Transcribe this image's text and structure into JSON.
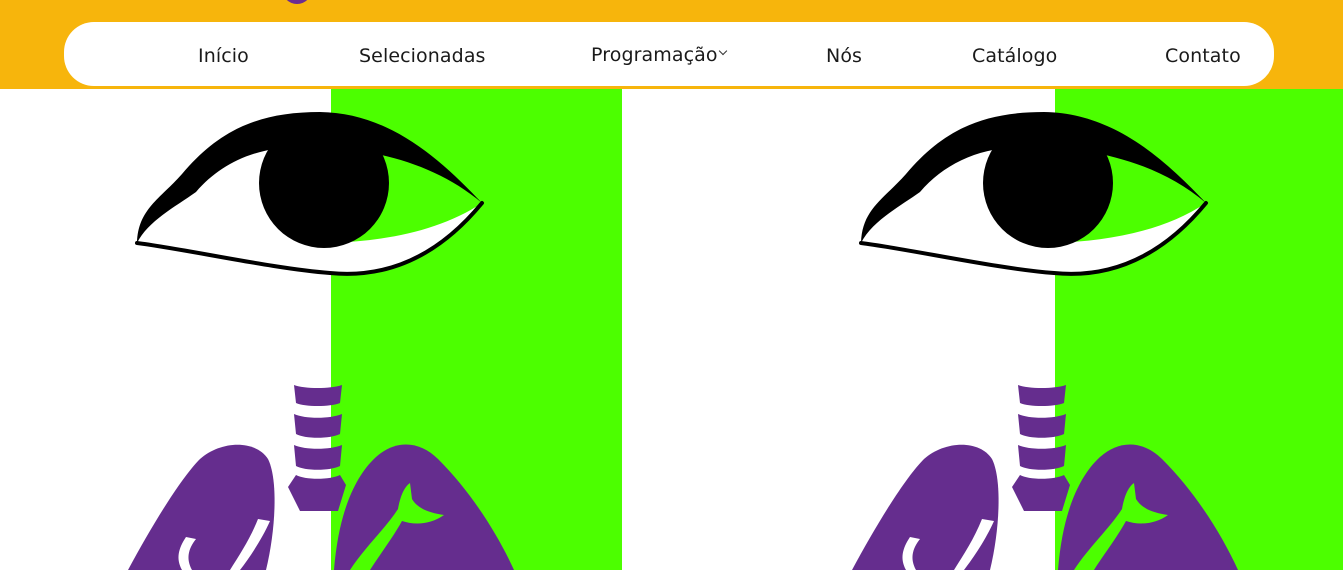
{
  "nav": {
    "items": [
      {
        "label": "Início"
      },
      {
        "label": "Selecionadas"
      },
      {
        "label": "Programação"
      },
      {
        "label": "Nós"
      },
      {
        "label": "Catálogo"
      },
      {
        "label": "Contato"
      }
    ]
  },
  "icons": {
    "dropdown": "chevron-down-icon",
    "artwork_eye": "eye-illustration",
    "artwork_lungs": "lungs-illustration"
  },
  "colors": {
    "header_bg": "#f7b50c",
    "nav_bg": "#ffffff",
    "brand_purple": "#6c2c91",
    "lung_purple": "#652d8e",
    "art_green": "#4cff00",
    "art_black": "#000000"
  }
}
